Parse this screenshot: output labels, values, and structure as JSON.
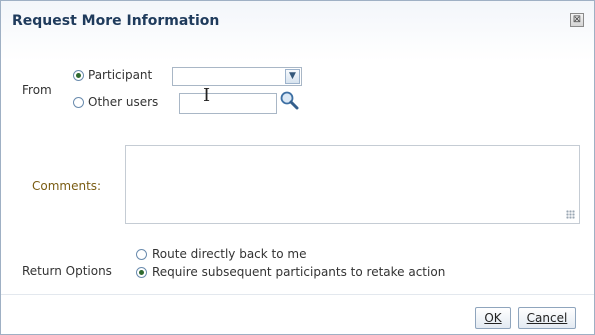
{
  "dialog": {
    "title": "Request More Information",
    "close_label": "⊠"
  },
  "from": {
    "label": "From",
    "participant_option": "Participant",
    "participant_selected": true,
    "participant_select_value": "",
    "other_users_option": "Other users",
    "other_users_selected": false,
    "other_users_value": ""
  },
  "comments": {
    "label": "Comments:",
    "value": ""
  },
  "return_options": {
    "label": "Return Options",
    "option_route": "Route directly back to me",
    "option_route_selected": false,
    "option_require": "Require subsequent participants to retake action",
    "option_require_selected": true
  },
  "buttons": {
    "ok": "OK",
    "cancel": "Cancel"
  },
  "colors": {
    "title": "#1f3b5c",
    "comments_label": "#7a5c12",
    "radio_checked": "#2f6a2f",
    "border": "#9fb0c4"
  },
  "icons": {
    "select_arrow": "chevron-down-icon",
    "search": "search-icon",
    "close": "close-icon",
    "resize": "resize-grip-icon"
  }
}
